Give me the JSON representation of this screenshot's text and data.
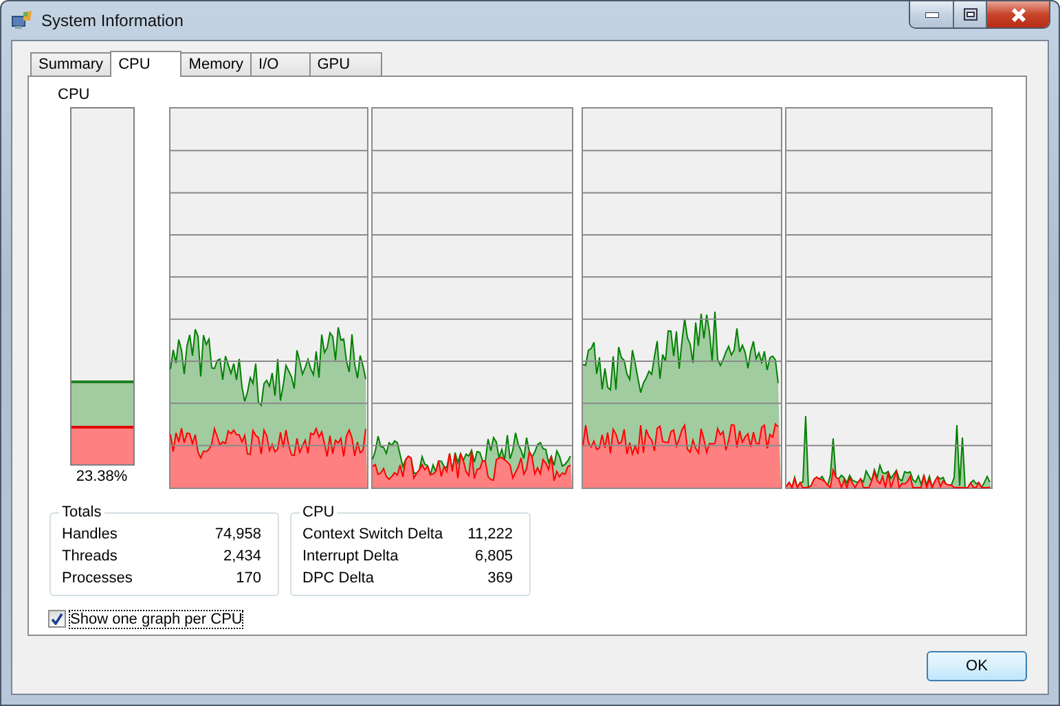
{
  "window": {
    "title": "System Information"
  },
  "tabs": [
    {
      "label": "Summary",
      "selected": false
    },
    {
      "label": "CPU",
      "selected": true
    },
    {
      "label": "Memory",
      "selected": false
    },
    {
      "label": "I/O",
      "selected": false
    },
    {
      "label": "GPU",
      "selected": false
    }
  ],
  "usage_meter": {
    "title": "CPU",
    "level": 0.2338,
    "kernel": {
      "level": 0.11
    },
    "reading": "23.38%"
  },
  "totals": {
    "title": "Totals",
    "rows": [
      {
        "label": "Handles",
        "value": "74,958"
      },
      {
        "label": "Threads",
        "value": "2,434"
      },
      {
        "label": "Processes",
        "value": "170"
      }
    ]
  },
  "cpu_stats": {
    "title": "CPU",
    "rows": [
      {
        "label": "Context Switch Delta",
        "value": "11,222"
      },
      {
        "label": "Interrupt Delta",
        "value": "6,805"
      },
      {
        "label": "DPC Delta",
        "value": "369"
      }
    ]
  },
  "per_cpu_option": {
    "label": "Show one graph per CPU",
    "checked": true
  },
  "buttons": {
    "ok": "OK"
  }
}
